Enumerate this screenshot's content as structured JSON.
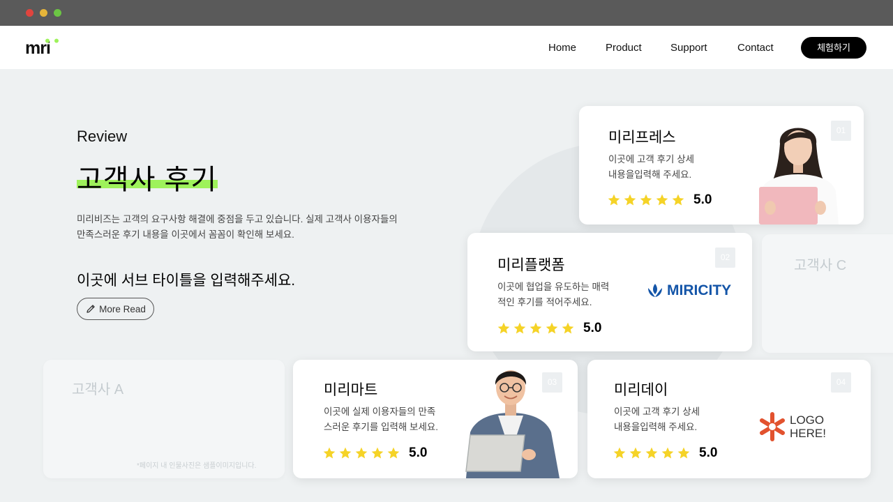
{
  "window": {
    "dots": [
      "#e0443e",
      "#e6b53a",
      "#6cc644"
    ]
  },
  "brand": {
    "logo_text": "mri",
    "accent": "#9ef25b"
  },
  "nav": {
    "items": [
      "Home",
      "Product",
      "Support",
      "Contact"
    ],
    "cta": "체험하기"
  },
  "hero": {
    "eyebrow": "Review",
    "title": "고객사 후기",
    "desc_line1": "미리비즈는 고객의 요구사항 해결에 중점을 두고 있습니다. 실제 고객사 이용자들의",
    "desc_line2": "만족스러운 후기 내용을 이곳에서 꼼꼼이 확인해 보세요.",
    "subtitle": "이곳에 서브 타이틀을 입력해주세요.",
    "more_label": "More Read",
    "more_icon": "pencil-icon"
  },
  "cards": [
    {
      "num": "01",
      "title": "미리프레스",
      "text_line1": "이곳에 고객 후기 상세",
      "text_line2": "내용을입력해 주세요.",
      "score": "5.0",
      "media": "woman-photo"
    },
    {
      "num": "02",
      "title": "미리플랫폼",
      "text_line1": "이곳에 협업을 유도하는 매력",
      "text_line2": "적인 후기를 적어주세요.",
      "score": "5.0",
      "media": "logo",
      "logo_text": "MIRICITY",
      "logo_color": "#1455a8"
    },
    {
      "num": "03",
      "title": "미리마트",
      "text_line1": "이곳에 실제 이용자들의 만족",
      "text_line2": "스러운 후기를 입력해 보세요.",
      "score": "5.0",
      "media": "man-photo"
    },
    {
      "num": "04",
      "title": "미리데이",
      "text_line1": "이곳에 고객 후기 상세",
      "text_line2": "내용을입력해 주세요.",
      "score": "5.0",
      "media": "logo",
      "logo_line1": "LOGO",
      "logo_line2": "HERE!",
      "logo_color": "#e2522e"
    }
  ],
  "ghosts": {
    "a": "고객사 A",
    "c": "고객사 C"
  },
  "footnote": "*페이지 내 인물사진은 샘플이미지입니다.",
  "rating": {
    "stars": 5,
    "max": 5,
    "star_color": "#f5d327"
  }
}
